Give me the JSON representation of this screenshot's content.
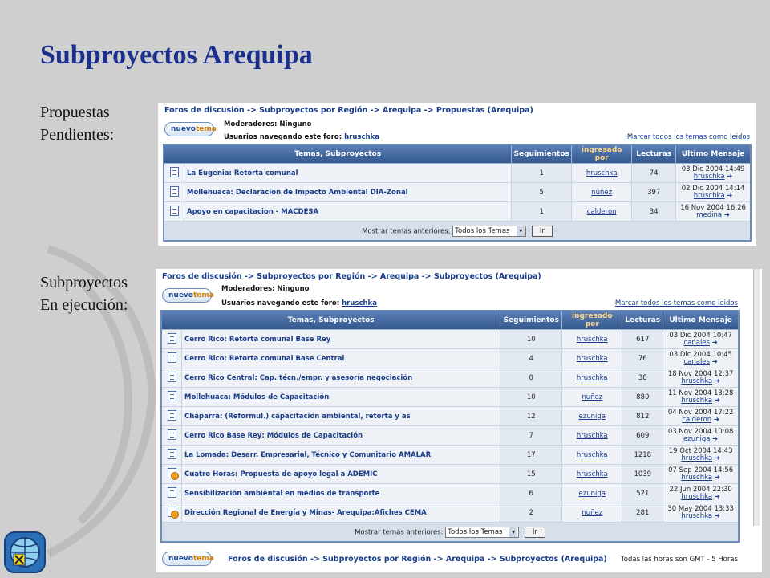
{
  "title": "Subproyectos Arequipa",
  "labels": {
    "pending_line1": "Propuestas",
    "pending_line2": "Pendientes:",
    "exec_line1": "Subproyectos",
    "exec_line2": "En ejecución:"
  },
  "common": {
    "new_topic_a": "nuevo",
    "new_topic_b": "tema",
    "moderators": "Moderadores: Ninguno",
    "browsing": "Usuarios navegando este foro:",
    "browsing_user": "hruschka",
    "mark_all": "Marcar todos los temas como leidos",
    "col_topics": "Temas, Subproyectos",
    "col_follow": "Seguimientos",
    "col_entered": "ingresado por",
    "col_reads": "Lecturas",
    "col_last": "Ultimo Mensaje",
    "show_prev": "Mostrar temas anteriores:",
    "select_value": "Todos los Temas",
    "go": "Ir",
    "timezone": "Todas las horas son GMT - 5 Horas"
  },
  "panel1": {
    "breadcrumb": "Foros de discusión -> Subproyectos por Región -> Arequipa -> Propuestas (Arequipa)",
    "rows": [
      {
        "icon": "topic-icon",
        "topic": "La Eugenia: Retorta comunal",
        "follow": "1",
        "by": "hruschka",
        "reads": "74",
        "date": "03 Dic 2004 14:49",
        "user": "hruschka"
      },
      {
        "icon": "topic-icon",
        "topic": "Mollehuaca: Declaración de Impacto Ambiental DIA-Zonal",
        "follow": "5",
        "by": "nuñez",
        "reads": "397",
        "date": "02 Dic 2004 14:14",
        "user": "hruschka"
      },
      {
        "icon": "topic-icon",
        "topic": "Apoyo en capacitacion - MACDESA",
        "follow": "1",
        "by": "calderon",
        "reads": "34",
        "date": "16 Nov 2004 16:26",
        "user": "medina"
      }
    ]
  },
  "panel2": {
    "breadcrumb": "Foros de discusión -> Subproyectos por Región -> Arequipa -> Subproyectos (Arequipa)",
    "rows": [
      {
        "icon": "topic-icon",
        "topic": "Cerro Rico: Retorta comunal Base Rey",
        "follow": "10",
        "by": "hruschka",
        "reads": "617",
        "date": "03 Dic 2004 10:47",
        "user": "canales"
      },
      {
        "icon": "topic-icon",
        "topic": "Cerro Rico: Retorta comunal Base Central",
        "follow": "4",
        "by": "hruschka",
        "reads": "76",
        "date": "03 Dic 2004 10:45",
        "user": "canales"
      },
      {
        "icon": "topic-icon",
        "topic": "Cerro Rico Central: Cap. técn./empr. y asesoría negociación",
        "follow": "0",
        "by": "hruschka",
        "reads": "38",
        "date": "18 Nov 2004 12:37",
        "user": "hruschka"
      },
      {
        "icon": "topic-icon",
        "topic": "Mollehuaca: Módulos de Capacitación",
        "follow": "10",
        "by": "nuñez",
        "reads": "880",
        "date": "11 Nov 2004 13:28",
        "user": "hruschka"
      },
      {
        "icon": "topic-icon",
        "topic": "Chaparra: (Reformul.) capacitación ambiental, retorta y as",
        "follow": "12",
        "by": "ezuniga",
        "reads": "812",
        "date": "04 Nov 2004 17:22",
        "user": "calderon"
      },
      {
        "icon": "topic-icon",
        "topic": "Cerro Rico Base Rey: Módulos de Capacitación",
        "follow": "7",
        "by": "hruschka",
        "reads": "609",
        "date": "03 Nov 2004 10:08",
        "user": "ezuniga"
      },
      {
        "icon": "topic-icon",
        "topic": "La Lomada: Desarr. Empresarial, Técnico y Comunitario AMALAR",
        "follow": "17",
        "by": "hruschka",
        "reads": "1218",
        "date": "19 Oct 2004 14:43",
        "user": "hruschka"
      },
      {
        "icon": "hot-topic-icon",
        "topic": "Cuatro Horas: Propuesta de apoyo legal a ADEMIC",
        "follow": "15",
        "by": "hruschka",
        "reads": "1039",
        "date": "07 Sep 2004 14:56",
        "user": "hruschka"
      },
      {
        "icon": "topic-icon",
        "topic": "Sensibilización ambiental en medios de transporte",
        "follow": "6",
        "by": "ezuniga",
        "reads": "521",
        "date": "22 Jun 2004 22:30",
        "user": "hruschka"
      },
      {
        "icon": "hot-topic-icon",
        "topic": "Dirección Regional de Energía y Minas- Arequipa:Afiches CEMA",
        "follow": "2",
        "by": "nuñez",
        "reads": "281",
        "date": "30 May 2004 13:33",
        "user": "hruschka"
      }
    ]
  }
}
